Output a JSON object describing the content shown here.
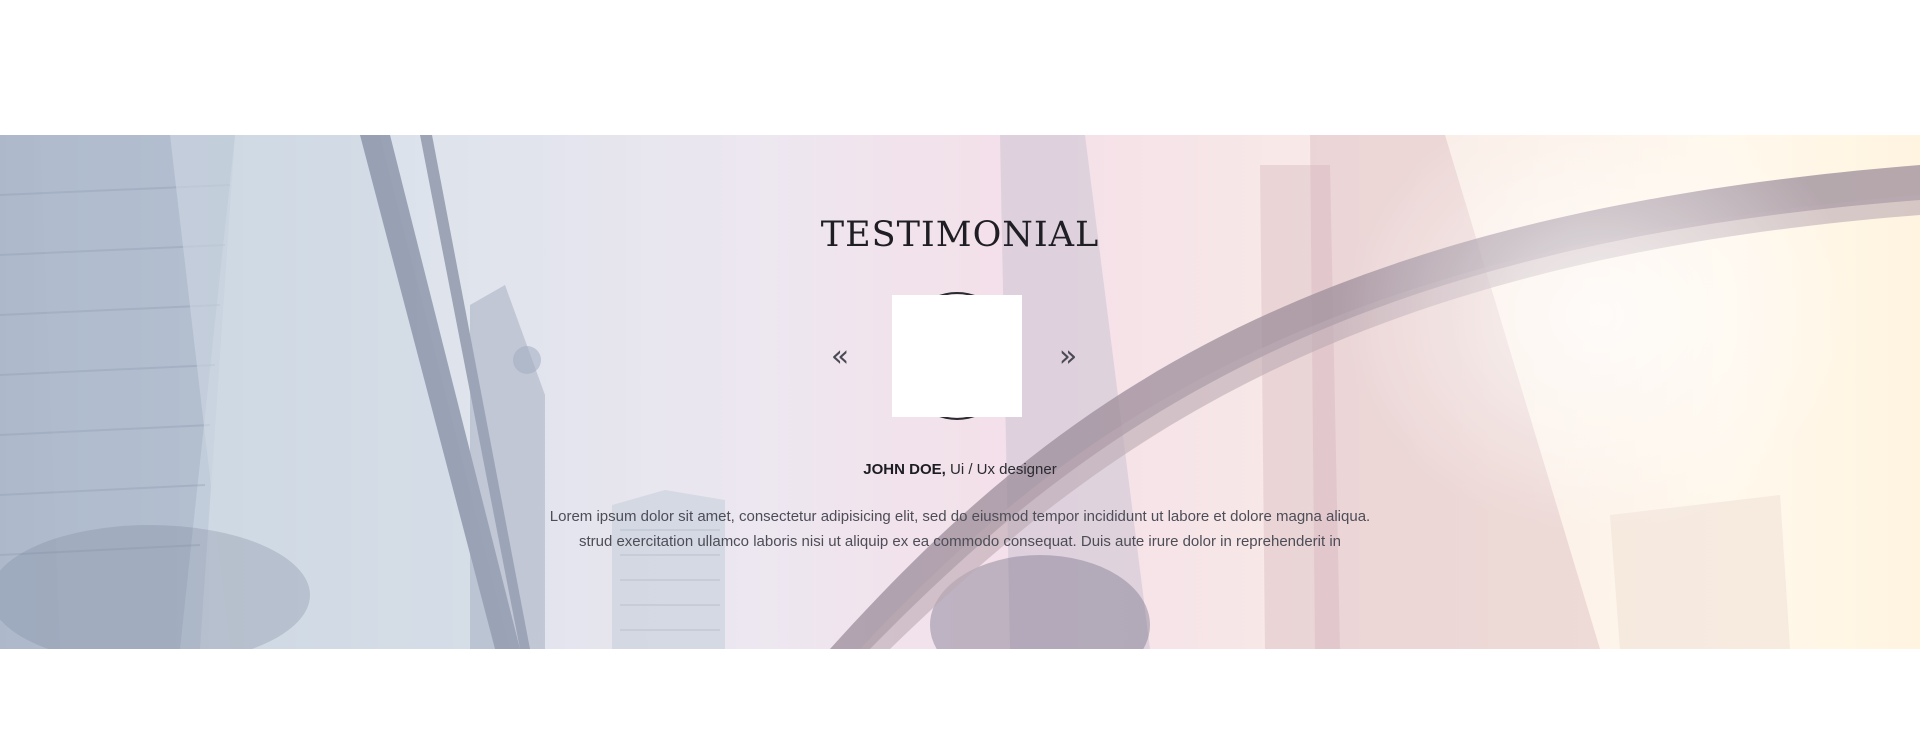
{
  "testimonial": {
    "title": "TESTIMONIAL",
    "prev_icon": "«",
    "next_icon": "»",
    "name": "JOHN DOE,",
    "role": "Ui / Ux designer",
    "quote_line_1": "Lorem ipsum dolor sit amet, consectetur adipisicing elit, sed do eiusmod tempor incididunt ut labore et dolore magna aliqua.",
    "quote_line_2": "strud exercitation ullamco laboris nisi ut aliquip ex ea commodo consequat. Duis aute irure dolor in reprehenderit in"
  },
  "icons": {
    "prev": "chevron-double-left-icon",
    "next": "chevron-double-right-icon"
  },
  "colors": {
    "title": "#1e1e24",
    "text": "#4d4d57",
    "band_left": "#b9c7d8",
    "band_mid": "#f3dce7",
    "band_right": "#fff3dc"
  }
}
